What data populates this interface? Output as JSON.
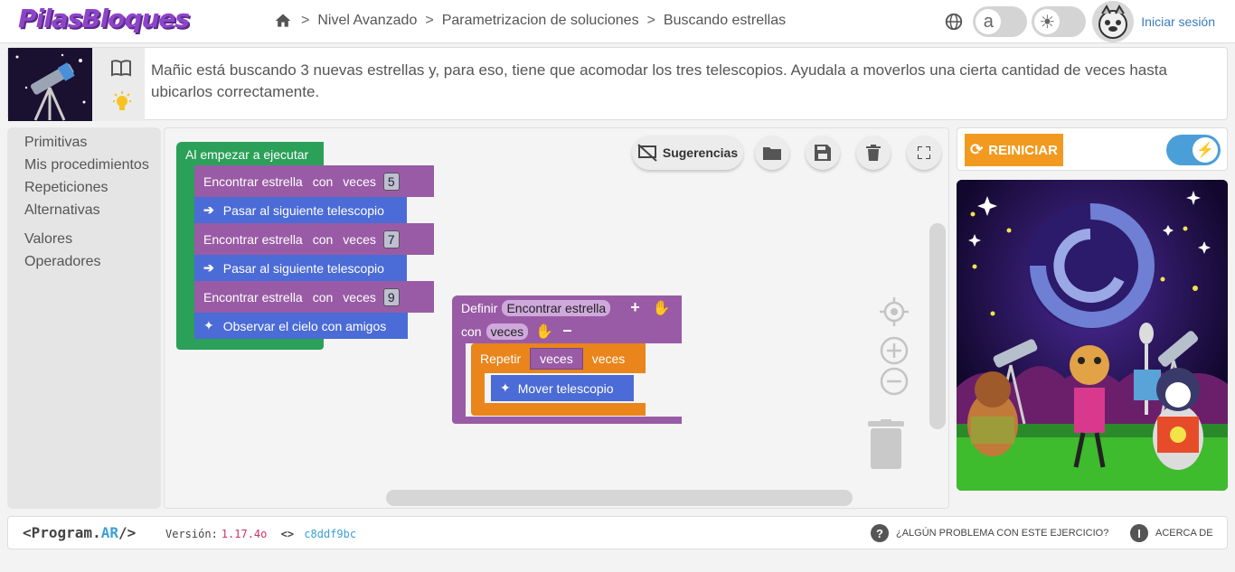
{
  "app": {
    "logo": "PilasBloques"
  },
  "breadcrumb": {
    "items": [
      "Nivel Avanzado",
      "Parametrizacion de soluciones",
      "Buscando estrellas"
    ]
  },
  "header": {
    "font_toggle_label": "a",
    "signin": "Iniciar sesión"
  },
  "challenge": {
    "description": "Mañic está buscando 3 nuevas estrellas y, para eso, tiene que acomodar los tres telescopios. Ayudala a moverlos una cierta cantidad de veces hasta ubicarlos correctamente."
  },
  "categories": [
    "Primitivas",
    "Mis procedimientos",
    "Repeticiones",
    "Alternativas",
    "Valores",
    "Operadores"
  ],
  "toolbar": {
    "hints": "Sugerencias"
  },
  "program": {
    "start": "Al empezar a ejecutar",
    "blocks": [
      {
        "label": "Encontrar estrella",
        "param": "con",
        "param2": "veces",
        "value": "5"
      },
      {
        "label": "Pasar al siguiente telescopio"
      },
      {
        "label": "Encontrar estrella",
        "param": "con",
        "param2": "veces",
        "value": "7"
      },
      {
        "label": "Pasar al siguiente telescopio"
      },
      {
        "label": "Encontrar estrella",
        "param": "con",
        "param2": "veces",
        "value": "9"
      },
      {
        "label": "Observar el cielo con amigos"
      }
    ]
  },
  "procedure": {
    "define": "Definir",
    "name": "Encontrar estrella",
    "with": "con",
    "param": "veces",
    "repeat": "Repetir",
    "repeat_var": "veces",
    "repeat_suffix": "veces",
    "action": "Mover telescopio"
  },
  "scene": {
    "reset": "REINICIAR"
  },
  "footer": {
    "brand_prefix": "<Program.",
    "brand_ar": "AR",
    "brand_suffix": "/>",
    "version_label": "Versión:",
    "version": "1.17.4o",
    "hash": "c8ddf9bc",
    "problem": "¿Algún problema con este ejercicio?",
    "about": "Acerca de"
  },
  "colors": {
    "start": "#2aa058",
    "procedure": "#995ba5",
    "motion": "#4b6bd6",
    "loop": "#e9851b",
    "accent": "#f19a1f",
    "link": "#3a7bbf"
  }
}
